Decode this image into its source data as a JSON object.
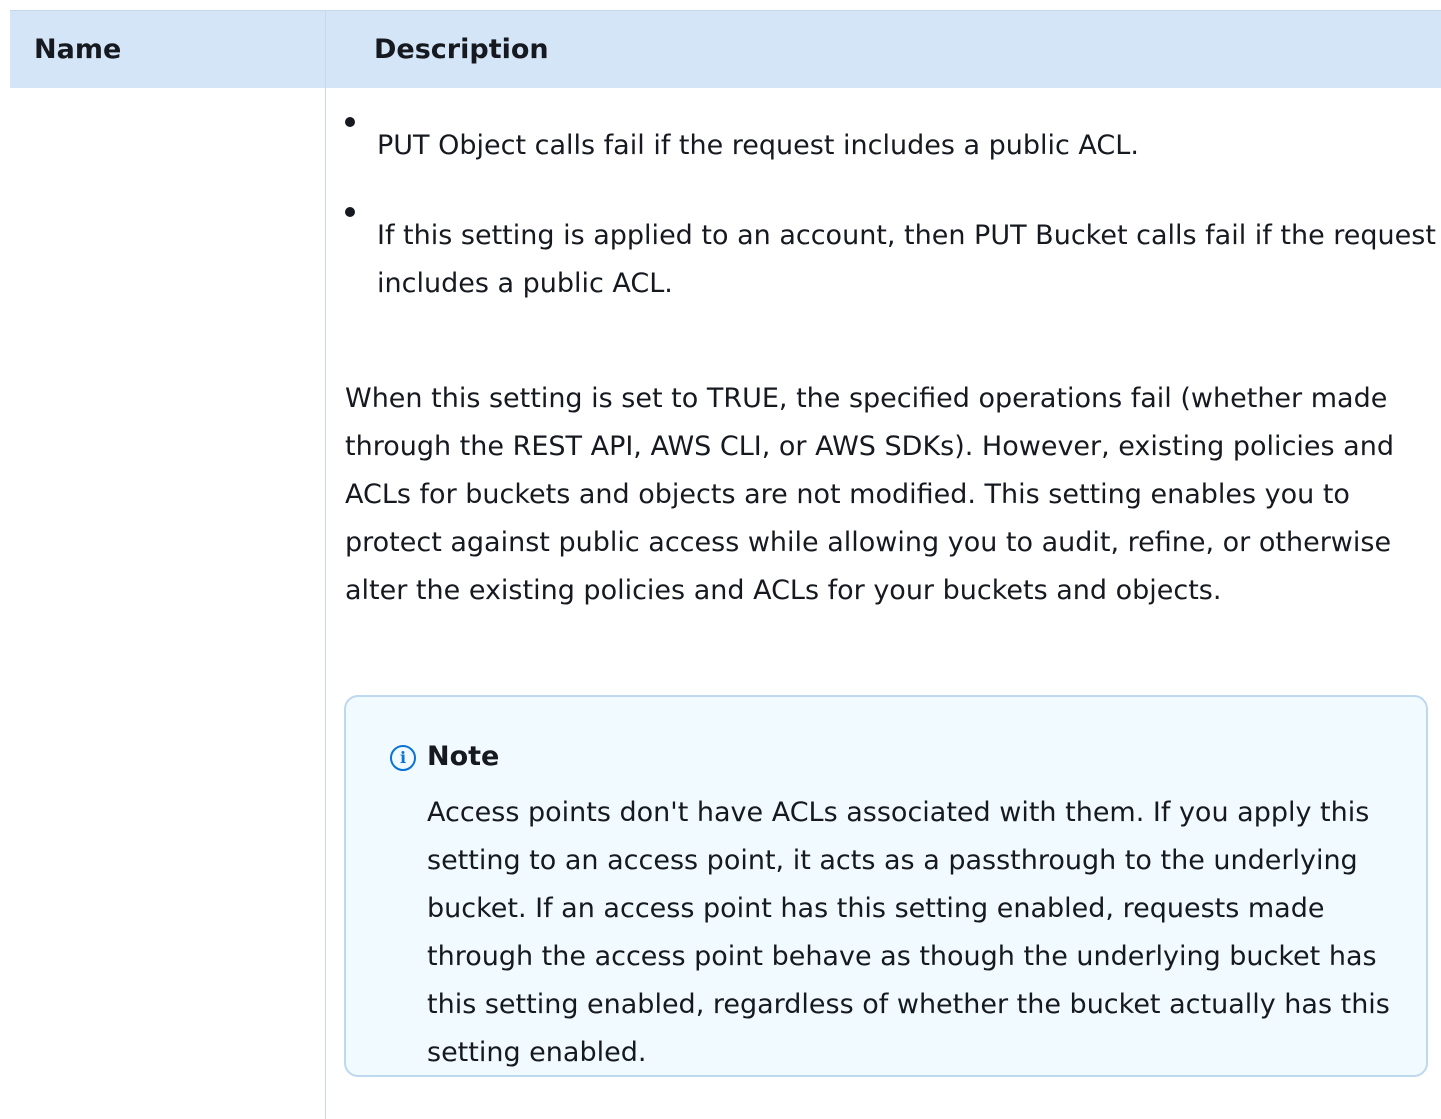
{
  "table": {
    "headers": {
      "name": "Name",
      "description": "Description"
    },
    "row": {
      "bullets": [
        "PUT Object calls fail if the request includes a public  ACL.",
        "If this setting is applied to an account, then PUT Bucket  calls fail if the request includes a public ACL."
      ],
      "paragraph": "When this setting is set to TRUE, the specified operations fail (whether made through the REST API, AWS CLI, or AWS  SDKs). However, existing policies and ACLs for buckets and objects  are not modified. This setting enables you to protect against public  access while allowing you to audit, refine, or otherwise alter the  existing policies and ACLs for your buckets and objects.",
      "note": {
        "icon": "info-icon",
        "icon_glyph": "i",
        "title": "Note",
        "body": "Access points don't have ACLs associated with them. If you  apply this setting to an access point, it acts as a passthrough to the  underlying bucket. If an access point has this setting enabled, requests  made through the access point behave as though the underlying bucket has  this setting enabled, regardless of whether the bucket actually  has this setting enabled.",
        "accent_color": "#0972d3"
      }
    }
  }
}
